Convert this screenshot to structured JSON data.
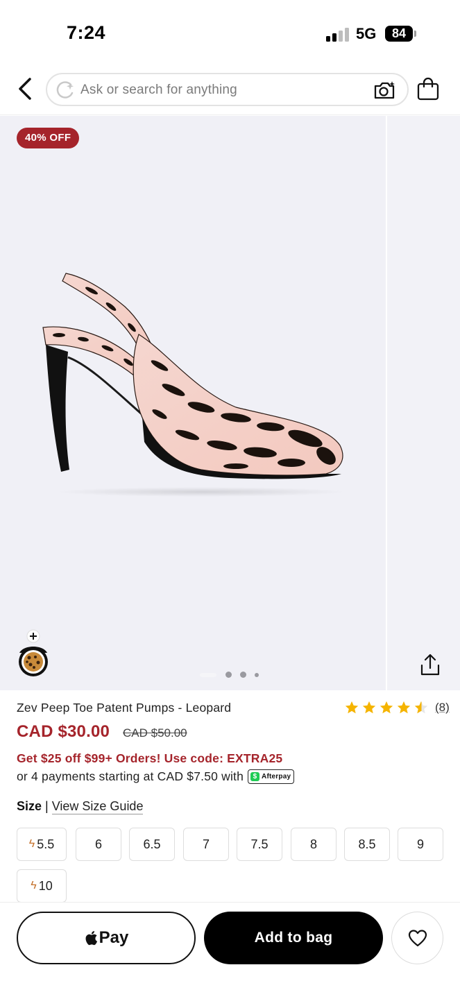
{
  "status_bar": {
    "time": "7:24",
    "network": "5G",
    "battery": "84"
  },
  "header": {
    "search_placeholder": "Ask or search for anything",
    "icons": [
      "back-chevron-icon",
      "sparkle-search-icon",
      "camera-search-icon",
      "shopping-bag-icon"
    ]
  },
  "gallery": {
    "discount_badge": "40% OFF",
    "image_count": 4,
    "active_index": 0,
    "swatch_icons": [
      "plus-icon",
      "leopard-swatch-icon"
    ],
    "share_icon": "share-icon"
  },
  "product": {
    "name": "Zev Peep Toe Patent Pumps - Leopard",
    "rating_value": 4.5,
    "rating_count": "(8)",
    "price_current": "CAD $30.00",
    "price_original": "CAD $50.00",
    "promo": "Get $25 off $99+ Orders! Use code: EXTRA25",
    "installments": "or 4 payments starting at CAD $7.50 with",
    "afterpay_label": "Afterpay",
    "afterpay_symbol": "$"
  },
  "size_section": {
    "label": "Size",
    "separator": "|",
    "guide_link": "View Size Guide",
    "options": [
      {
        "label": "5.5",
        "low_stock": true
      },
      {
        "label": "6",
        "low_stock": false
      },
      {
        "label": "6.5",
        "low_stock": false
      },
      {
        "label": "7",
        "low_stock": false
      },
      {
        "label": "7.5",
        "low_stock": false
      },
      {
        "label": "8",
        "low_stock": false
      },
      {
        "label": "8.5",
        "low_stock": false
      },
      {
        "label": "9",
        "low_stock": false
      },
      {
        "label": "10",
        "low_stock": true
      }
    ]
  },
  "actions": {
    "apple_pay_label": "Pay",
    "add_to_bag_label": "Add to bag",
    "wishlist_icon": "heart-icon"
  },
  "colors": {
    "accent_red": "#a5242b",
    "primary_black": "#000000",
    "star_yellow": "#f5b400",
    "bolt_orange": "#c4702a",
    "afterpay_green": "#1fcc55"
  }
}
